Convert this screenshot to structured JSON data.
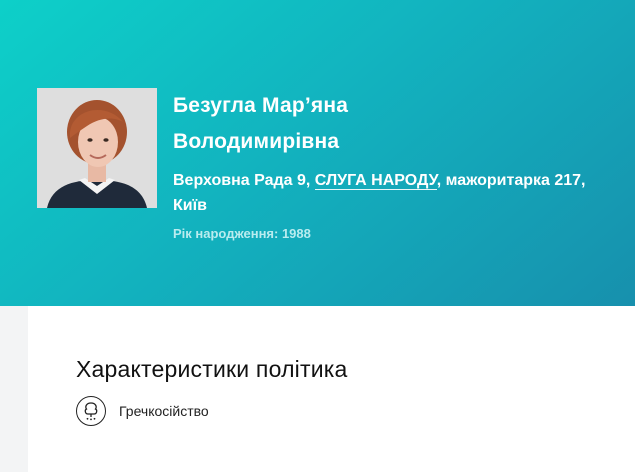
{
  "politician": {
    "name_line1": "Безугла Мар’яна",
    "name_line2": "Володимирівна",
    "affiliation_prefix": "Верховна Рада 9, ",
    "party_link": "СЛУГА НАРОДУ",
    "affiliation_suffix": ", мажоритарка 217, Київ",
    "birth_year": "Рік народження: 1988",
    "photo_icon": "portrait-photo"
  },
  "characteristics": {
    "title": "Характеристики політика",
    "items": [
      {
        "label": "Гречкосійство",
        "icon": "buckwheat-icon"
      }
    ]
  },
  "colors": {
    "hero_gradient_start": "#0dd0c9",
    "hero_gradient_end": "#1790ad",
    "birth_text": "#b9ecef"
  }
}
